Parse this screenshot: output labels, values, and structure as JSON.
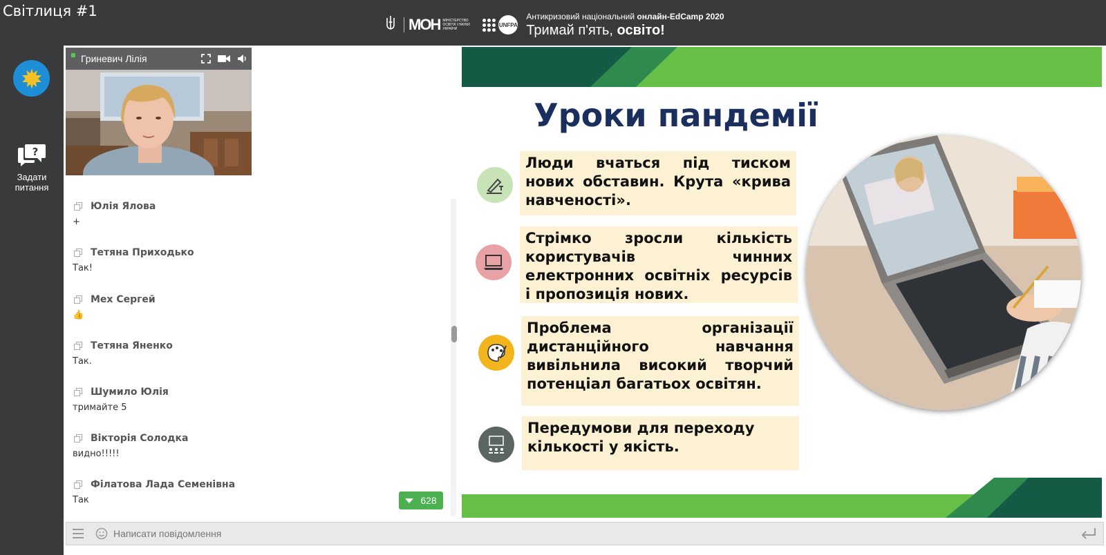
{
  "header": {
    "room_title": "Світлиця #1",
    "ministry_logo": "МОН",
    "ministry_text": "Міністерство освіти і науки України",
    "partner_logo": "UNFPA",
    "event_line1_regular": "Антикризовий національний",
    "event_line1_bold": "онлайн-EdCamp 2020",
    "event_line2_regular": "Тримай п'ять,",
    "event_line2_bold": "освіто!"
  },
  "sidebar": {
    "logo_icon": "maple-leaf-icon",
    "ask_icon": "question-chat-icon",
    "ask_label_line1": "Задати",
    "ask_label_line2": "питання"
  },
  "video": {
    "speaker_name": "Гриневич Лілія",
    "icons": [
      "fullscreen-icon",
      "camera-icon",
      "speaker-icon"
    ]
  },
  "chat": {
    "messages": [
      {
        "author": "Юлія Ялова",
        "text": "+"
      },
      {
        "author": "Тетяна Приходько",
        "text": "Так!"
      },
      {
        "author": "Мех Сергей",
        "text": "👍"
      },
      {
        "author": "Тетяна Яненко",
        "text": "Так."
      },
      {
        "author": "Шумило Юлія",
        "text": "тримайте 5"
      },
      {
        "author": "Вікторія Солодка",
        "text": "видно!!!!!"
      },
      {
        "author": "Філатова Лада Семенівна",
        "text": "Так"
      }
    ],
    "unread_count": "628"
  },
  "composer": {
    "placeholder": "Написати повідомлення"
  },
  "slide": {
    "title": "Уроки пандемії",
    "bullets": [
      {
        "text": "Люди вчаться під тиском нових обставин. Крута «крива",
        "last": "навченості».",
        "icon": "handwriting-icon",
        "color": "#c8e3b8"
      },
      {
        "text": "Стрімко зросли кількість користувачів чинних електронних освітніх ресурсів",
        "last": "і пропозиція нових.",
        "icon": "laptop-icon",
        "color": "#e8a2a6"
      },
      {
        "text": "Проблема організації дистанційного навчання вивільнила високий творчий",
        "last": "потенціал багатьох освітян.",
        "icon": "palette-icon",
        "color": "#f3b51e"
      },
      {
        "text": "Передумови для переходу",
        "last": "кількості у якість.",
        "icon": "presentation-icon",
        "color": "#5c6660"
      }
    ]
  },
  "colors": {
    "dark_bar": "#383a3b",
    "slide_green": "#67bf47",
    "slide_dark_green": "#155a45",
    "slide_title": "#1b2f5e",
    "bullet_bg": "#fdf1d3",
    "badge_green": "#4caf50"
  }
}
